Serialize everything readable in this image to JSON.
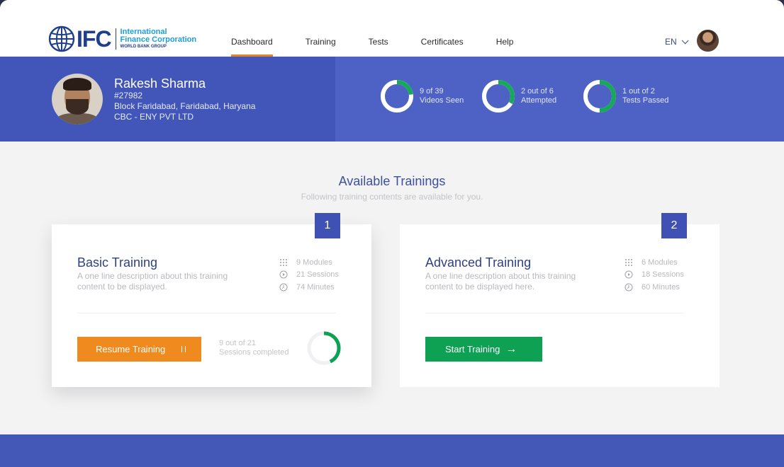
{
  "brand": {
    "logo_mark": "IFC",
    "line1": "International",
    "line2": "Finance Corporation",
    "line3": "WORLD BANK GROUP"
  },
  "nav": {
    "items": [
      {
        "label": "Dashboard",
        "active": true
      },
      {
        "label": "Training",
        "active": false
      },
      {
        "label": "Tests",
        "active": false
      },
      {
        "label": "Certificates",
        "active": false
      },
      {
        "label": "Help",
        "active": false
      }
    ],
    "language": "EN"
  },
  "profile": {
    "name": "Rakesh Sharma",
    "id": "#27982",
    "location": "Block Faridabad, Faridabad, Haryana",
    "org": "CBC - ENY PVT LTD"
  },
  "stats": [
    {
      "line1": "9 of 39",
      "line2": "Videos Seen",
      "fraction": 0.23
    },
    {
      "line1": "2 out of 6",
      "line2": "Attempted",
      "fraction": 0.33
    },
    {
      "line1": "1 out of 2",
      "line2": "Tests Passed",
      "fraction": 0.5
    }
  ],
  "section": {
    "title": "Available Trainings",
    "subtitle": "Following training contents are available for you."
  },
  "trainings": [
    {
      "badge": "1",
      "title": "Basic Training",
      "description": "A one line description about this training content to be displayed.",
      "modules": "9 Modules",
      "sessions": "21 Sessions",
      "minutes": "74 Minutes",
      "button": "Resume Training",
      "progress_line1": "9 out of 21",
      "progress_line2": "Sessions completed",
      "progress_fraction": 0.43
    },
    {
      "badge": "2",
      "title": "Advanced Training",
      "description": "A one line description about this training content to be displayed here.",
      "modules": "6 Modules",
      "sessions": "18 Sessions",
      "minutes": "60 Minutes",
      "button": "Start Training"
    }
  ],
  "colors": {
    "primary": "#4156b8",
    "accent_orange": "#ef8a1f",
    "accent_green": "#0ea053",
    "title_blue": "#2f3f86"
  }
}
